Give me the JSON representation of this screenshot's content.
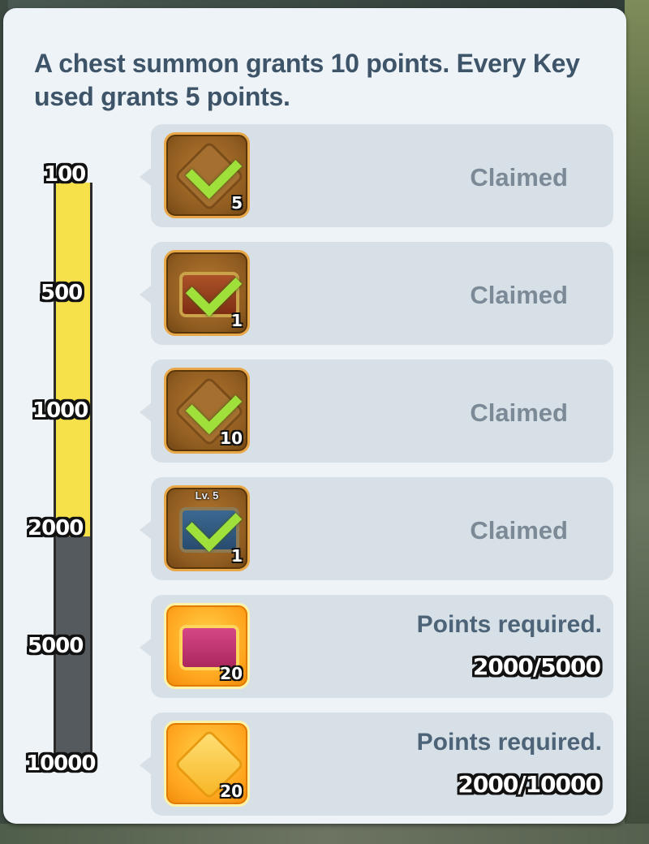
{
  "header": {
    "text": "A chest summon grants 10 points. Every Key used grants 5 points."
  },
  "progress": {
    "current_points": 2000,
    "milestones": [
      "100",
      "500",
      "1000",
      "2000",
      "5000",
      "10000"
    ]
  },
  "rewards": [
    {
      "icon": "puzzle-piece-icon",
      "count": "5",
      "status": "Claimed"
    },
    {
      "icon": "red-chest-icon",
      "count": "1",
      "status": "Claimed"
    },
    {
      "icon": "puzzle-piece-icon",
      "count": "10",
      "status": "Claimed"
    },
    {
      "icon": "blue-chest-icon",
      "level": "Lv. 5",
      "count": "1",
      "status": "Claimed"
    },
    {
      "icon": "golden-chest-icon",
      "count": "20",
      "status": "Points required.",
      "progress": "2000/5000"
    },
    {
      "icon": "golden-puzzle-piece-icon",
      "count": "20",
      "status": "Points required.",
      "progress": "2000/10000"
    }
  ],
  "colors": {
    "panel_bg": "#eef3f7",
    "row_bg": "#d8e0e7",
    "header_text": "#3d5469",
    "claimed_text": "#7b8a96",
    "progress_fill": "#f7e14a",
    "progress_empty": "#555a5e",
    "check": "#9fe03a"
  }
}
